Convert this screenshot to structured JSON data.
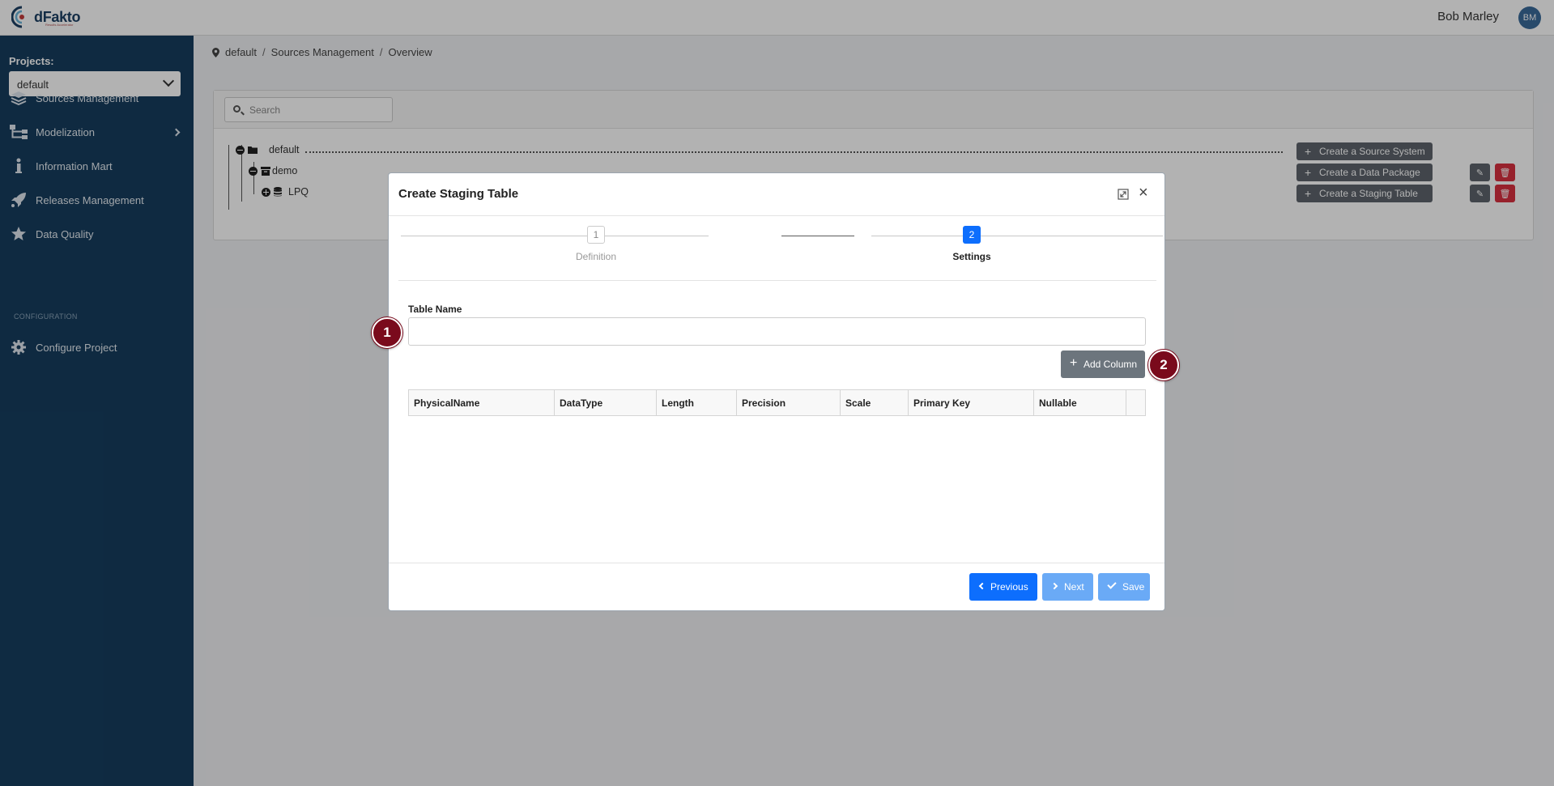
{
  "header": {
    "logo_text": "dFakto",
    "logo_tagline": "Results Accelerator",
    "user_name": "Bob Marley",
    "user_initials": "BM"
  },
  "sidebar": {
    "projects_label": "Projects:",
    "project_selected": "default",
    "items": [
      {
        "label": "Sources Management",
        "icon": "layers-icon"
      },
      {
        "label": "Modelization",
        "icon": "sitemap-icon"
      },
      {
        "label": "Information Mart",
        "icon": "info-icon"
      },
      {
        "label": "Releases Management",
        "icon": "rocket-icon"
      },
      {
        "label": "Data Quality",
        "icon": "star-icon"
      }
    ],
    "configuration_label": "CONFIGURATION",
    "config_items": [
      {
        "label": "Configure Project",
        "icon": "gear-icon"
      }
    ]
  },
  "breadcrumb": [
    "default",
    "Sources Management",
    "Overview"
  ],
  "search": {
    "placeholder": "Search"
  },
  "tree": {
    "nodes": [
      {
        "label": "default",
        "button": "Create a Source System"
      },
      {
        "label": "demo",
        "button": "Create a Data Package"
      },
      {
        "label": "LPQ",
        "button": "Create a Staging Table"
      }
    ]
  },
  "modal": {
    "title": "Create Staging Table",
    "steps": [
      {
        "number": "1",
        "label": "Definition",
        "active": false
      },
      {
        "number": "2",
        "label": "Settings",
        "active": true
      }
    ],
    "table_name_label": "Table Name",
    "table_name_value": "",
    "add_column_label": "Add Column",
    "columns": [
      "PhysicalName",
      "DataType",
      "Length",
      "Precision",
      "Scale",
      "Primary Key",
      "Nullable",
      ""
    ],
    "buttons": {
      "previous": "Previous",
      "next": "Next",
      "save": "Save"
    }
  },
  "markers": [
    "1",
    "2"
  ],
  "colors": {
    "sidebar": "#163d5e",
    "primary": "#0d6efd",
    "danger": "#d9303f",
    "secondary": "#6c757d",
    "marker": "#7a0a1c"
  }
}
